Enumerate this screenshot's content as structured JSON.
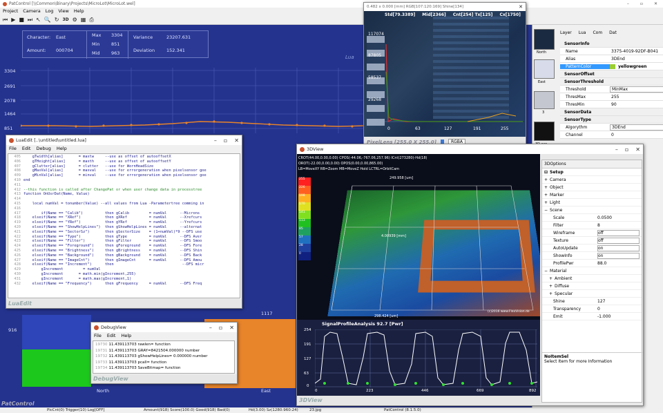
{
  "app": {
    "title": "PatControl [\\\\Common\\Binary\\Projects\\MicroLot\\MicroLot.wel]",
    "menu": [
      "Project",
      "Camera",
      "Log",
      "View",
      "Help"
    ],
    "window_controls": [
      "–",
      "▫",
      "✕"
    ]
  },
  "stats": {
    "character_label": "Character:",
    "character": "East",
    "amount_label": "Amount:",
    "amount": "000704",
    "max_label": "Max",
    "max": "3304",
    "min_label": "Min",
    "min": "851",
    "mid_label": "Mid",
    "mid": "963",
    "variance_label": "Variance",
    "variance": "23207.631",
    "deviation_label": "Deviation",
    "deviation": "152.341",
    "lua_mark": "Lua"
  },
  "yaxis": [
    "3304",
    "2691",
    "2078",
    "1464",
    "851"
  ],
  "bottom_labels": {
    "left_val": "916",
    "right_val": "1117",
    "north": "North",
    "east": "East",
    "pat": "PatControl"
  },
  "statusbar": [
    "PicCnt(0) Trigger(10) Log[OFF]",
    "Amount(918) Score(100.0) Good(918) Bad(0)",
    "Hd(3.00) Sz(1280:960:24)",
    "23.jpg",
    "PatControl (8.1.5.0)"
  ],
  "luaedit": {
    "title": "LuaEdit [..\\untitled\\untitled.lua]",
    "menu": [
      "File",
      "Edit",
      "Debug",
      "Help"
    ],
    "footer": "LuaEdit",
    "lines": [
      {
        "n": "405",
        "t": "    gTwidth[alias]       = maxtw     --use as offset of autooffsetX"
      },
      {
        "n": "406",
        "t": "    gTHeight[alias]      = maxth     --use as offset of autooffsetY"
      },
      {
        "n": "407",
        "t": "    gClutter[alias]      = clutter   --use for WornHeadSize"
      },
      {
        "n": "408",
        "t": "    gMaxVal[alias]       = maxval    --use for errorgeneration when pixelsensor goe"
      },
      {
        "n": "409",
        "t": "    gMinVal[alias]       = minval    --use for errorgeneration when pixelsensor goe"
      },
      {
        "n": "410",
        "t": "end"
      },
      {
        "n": "411",
        "t": ""
      },
      {
        "n": "412",
        "t": "--this function is called after ChangePat or when user change data in processtree"
      },
      {
        "n": "413",
        "t": "function OnUsrDat(Name, Value)"
      },
      {
        "n": "414",
        "t": ""
      },
      {
        "n": "415",
        "t": "    local numVal = tonumber(Value) --all values from Lua -Parametertree comming in"
      },
      {
        "n": "416",
        "t": ""
      },
      {
        "n": "417",
        "t": "        if(Name == \"Calib\")          then gCalib         = numVal      --Microns"
      },
      {
        "n": "418",
        "t": "    elseif(Name == \"XRef\")           then gXRef          = numVal      --Xrefcurs"
      },
      {
        "n": "419",
        "t": "    elseif(Name == \"YRef\")           then gYRef          = numVal      --Yrefcurs"
      },
      {
        "n": "420",
        "t": "    elseif(Name == \"ShowHelpLines\")  then gShowHelpLines = numVal      --alternat"
      },
      {
        "n": "421",
        "t": "    elseif(Name == \"SectorSz\")       then gSectorSize    = (1+numVal)*9 --DFS use"
      },
      {
        "n": "422",
        "t": "    elseif(Name == \"Type\")           then gType          = numVal      --DFS Aver"
      },
      {
        "n": "423",
        "t": "    elseif(Name == \"Filter\")         then gFilter        = numVal      --DFS Smoo"
      },
      {
        "n": "424",
        "t": "    elseif(Name == \"Foreground\")     then gForeground    = numVal      --DFS Fore"
      },
      {
        "n": "425",
        "t": "    elseif(Name == \"Brightness\")     then gBrightness    = numVal      --DFS Shin"
      },
      {
        "n": "426",
        "t": "    elseif(Name == \"Background\")     then gBackground    = numVal      --DFS Back"
      },
      {
        "n": "427",
        "t": "    elseif(Name == \"ImageCnt\")       then gImageCnt      = numVal      --DFS Amou"
      },
      {
        "n": "428",
        "t": "    elseif(Name == \"Increment\")      then                               --DFS micr"
      },
      {
        "n": "429",
        "t": "        gIncrement         = numVal"
      },
      {
        "n": "430",
        "t": "        gIncrement       = math.min(gIncrement,255)"
      },
      {
        "n": "431",
        "t": "        gIncrement       = math.max(gIncrement,1)"
      },
      {
        "n": "432",
        "t": "    elseif(Name == \"Frequency\")      then gFrequency     = numVal      --DFS Freq"
      }
    ]
  },
  "debug": {
    "title": "DebugView",
    "menu": [
      "File",
      "Edit",
      "Help"
    ],
    "footer": "DebugView",
    "lines": [
      {
        "n": "19730",
        "t": "11.439113703 rawlen= function"
      },
      {
        "n": "19731",
        "t": "11.439113703 GRAY=8421504.000000 number"
      },
      {
        "n": "19732",
        "t": "11.439113703 gShowHelpLines= 0.000000 number"
      },
      {
        "n": "19733",
        "t": "11.439113703 pcall= function"
      },
      {
        "n": "19734",
        "t": "11.439113703 SaveBitmap= function"
      }
    ]
  },
  "pixellens": {
    "title": "0.482 x 0.000 [mm] RGB[107:120:169] Shine[134]",
    "std": "Std[79.3389]",
    "mid": "Mid[2366]",
    "cnt": "Cnt[254] Tx[125]",
    "cx": "Cx[1750]",
    "yvals": [
      "117074",
      "87805",
      "58537",
      "29268"
    ],
    "xvals": [
      "0",
      "63",
      "127",
      "191",
      "255"
    ],
    "footer": "PixelLens  [255.0 X 255.0]",
    "mode": "RGBA"
  },
  "view3d": {
    "title": "3DView",
    "info1": "CROT(44.00,0.00,0.00) CPOS(-44.06,-767.06,257.96) ICnt(273280)-Hd(18)",
    "info2": "OROT(-22.00,0.00,0.00) OPOS(0.00,0.00,865.00)",
    "info3": "LB=MoveXY RB=Zoom MB=MoveZ Hold LCTRL=OrbitCam",
    "val_top": "249.958 [um]",
    "val_mid": "4.00939 [mm]",
    "val_left": "298.424 [mm]",
    "val_bot": "298.424 [um]",
    "legend": [
      "255",
      "226",
      "198",
      "170",
      "141",
      "113",
      "85",
      "57",
      "28",
      "0"
    ],
    "signal_title": "SignalProfileAnalysis 92.7 [Pwr]",
    "sig_y": [
      "254",
      "191",
      "127",
      "63",
      "0"
    ],
    "sig_x": [
      "0",
      "223",
      "446",
      "669",
      "892"
    ],
    "footer": "3DView",
    "credit": "(c)2016 www.FlexVision.de",
    "window_controls": [
      "–",
      "▫",
      "✕"
    ]
  },
  "opts3d": {
    "tab": "3DOptions",
    "groups": [
      {
        "name": "Setup",
        "bold": true,
        "sign": "⊟"
      },
      {
        "name": "Camera",
        "sign": "+"
      },
      {
        "name": "Object",
        "sign": "+"
      },
      {
        "name": "Marker",
        "sign": "+"
      },
      {
        "name": "Light",
        "sign": "+"
      },
      {
        "name": "Scene",
        "sign": "−"
      }
    ],
    "props": [
      {
        "k": "Scale",
        "v": "0.0500"
      },
      {
        "k": "Filter",
        "v": "8"
      },
      {
        "k": "Wireframe",
        "v": "off",
        "dd": true
      },
      {
        "k": "Texture",
        "v": "off",
        "dd": true
      },
      {
        "k": "AutoUpdate",
        "v": "on",
        "dd": true
      },
      {
        "k": "ShowInfo",
        "v": "on",
        "dd": true
      },
      {
        "k": "ProfilePwr",
        "v": "88.0"
      }
    ],
    "material": "Material",
    "mat": [
      {
        "name": "Ambient"
      },
      {
        "name": "Diffuse"
      },
      {
        "name": "Specular"
      }
    ],
    "matprops": [
      {
        "k": "Shine",
        "v": "127"
      },
      {
        "k": "Transparency",
        "v": "0"
      },
      {
        "k": "Emit",
        "v": "-1.000"
      }
    ],
    "noitem": "NoItemSel",
    "noitem_desc": "Select Item for more Information"
  },
  "props": {
    "tabs": [
      "Layer",
      "Lua",
      "Com",
      "Dat"
    ],
    "thumbs": [
      "North",
      "East",
      "3",
      "3D ear"
    ],
    "rows": [
      {
        "type": "group",
        "label": "SensorInfo"
      },
      {
        "k": "Name",
        "v": "3375-4019-92DF-B041"
      },
      {
        "k": "Alias",
        "v": "3DEnd"
      },
      {
        "k": "PatternColor",
        "v": "yellowgreen",
        "sel": true,
        "swatch": "#9acd32"
      },
      {
        "type": "group",
        "label": "SensorOffset"
      },
      {
        "type": "group",
        "label": "SensorThreshold"
      },
      {
        "k": "Threshold",
        "v": "MinMax",
        "dd": true
      },
      {
        "k": "ThresMax",
        "v": "255"
      },
      {
        "k": "ThresMin",
        "v": "90"
      },
      {
        "type": "group",
        "label": "SensorData"
      },
      {
        "type": "group",
        "label": "SensorType"
      },
      {
        "k": "Algorythm",
        "v": "3DEnd",
        "dd": true
      },
      {
        "k": "Channel",
        "v": "0"
      }
    ]
  },
  "colors": {
    "accent": "#3399ff",
    "chart_bg": "#2c3a9a",
    "orange": "#e8842a"
  }
}
